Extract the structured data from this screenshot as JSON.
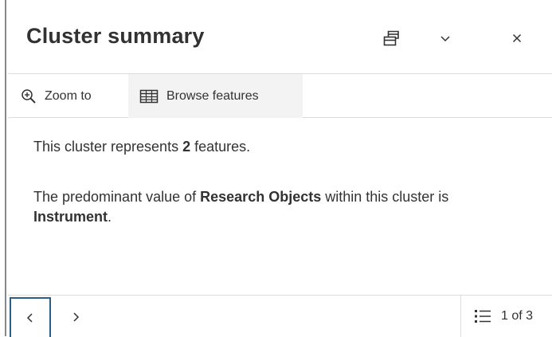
{
  "popup": {
    "title": "Cluster summary",
    "header_icons": [
      "dock-icon",
      "chevron-down-icon",
      "close-icon"
    ]
  },
  "toolbar": {
    "zoom_label": "Zoom to",
    "browse_label": "Browse features"
  },
  "content": {
    "line1_prefix": "This cluster represents ",
    "line1_count": "2",
    "line1_suffix": " features.",
    "line2_prefix": "The predominant value of ",
    "line2_field": "Research Objects",
    "line2_middle": " within this cluster is ",
    "line2_value": "Instrument",
    "line2_suffix": "."
  },
  "footer": {
    "pager_text": "1 of 3"
  },
  "colors": {
    "text": "#323232",
    "border": "#dcdcdc",
    "focus": "#2b5f87",
    "hover_bg": "#f3f3f3"
  }
}
